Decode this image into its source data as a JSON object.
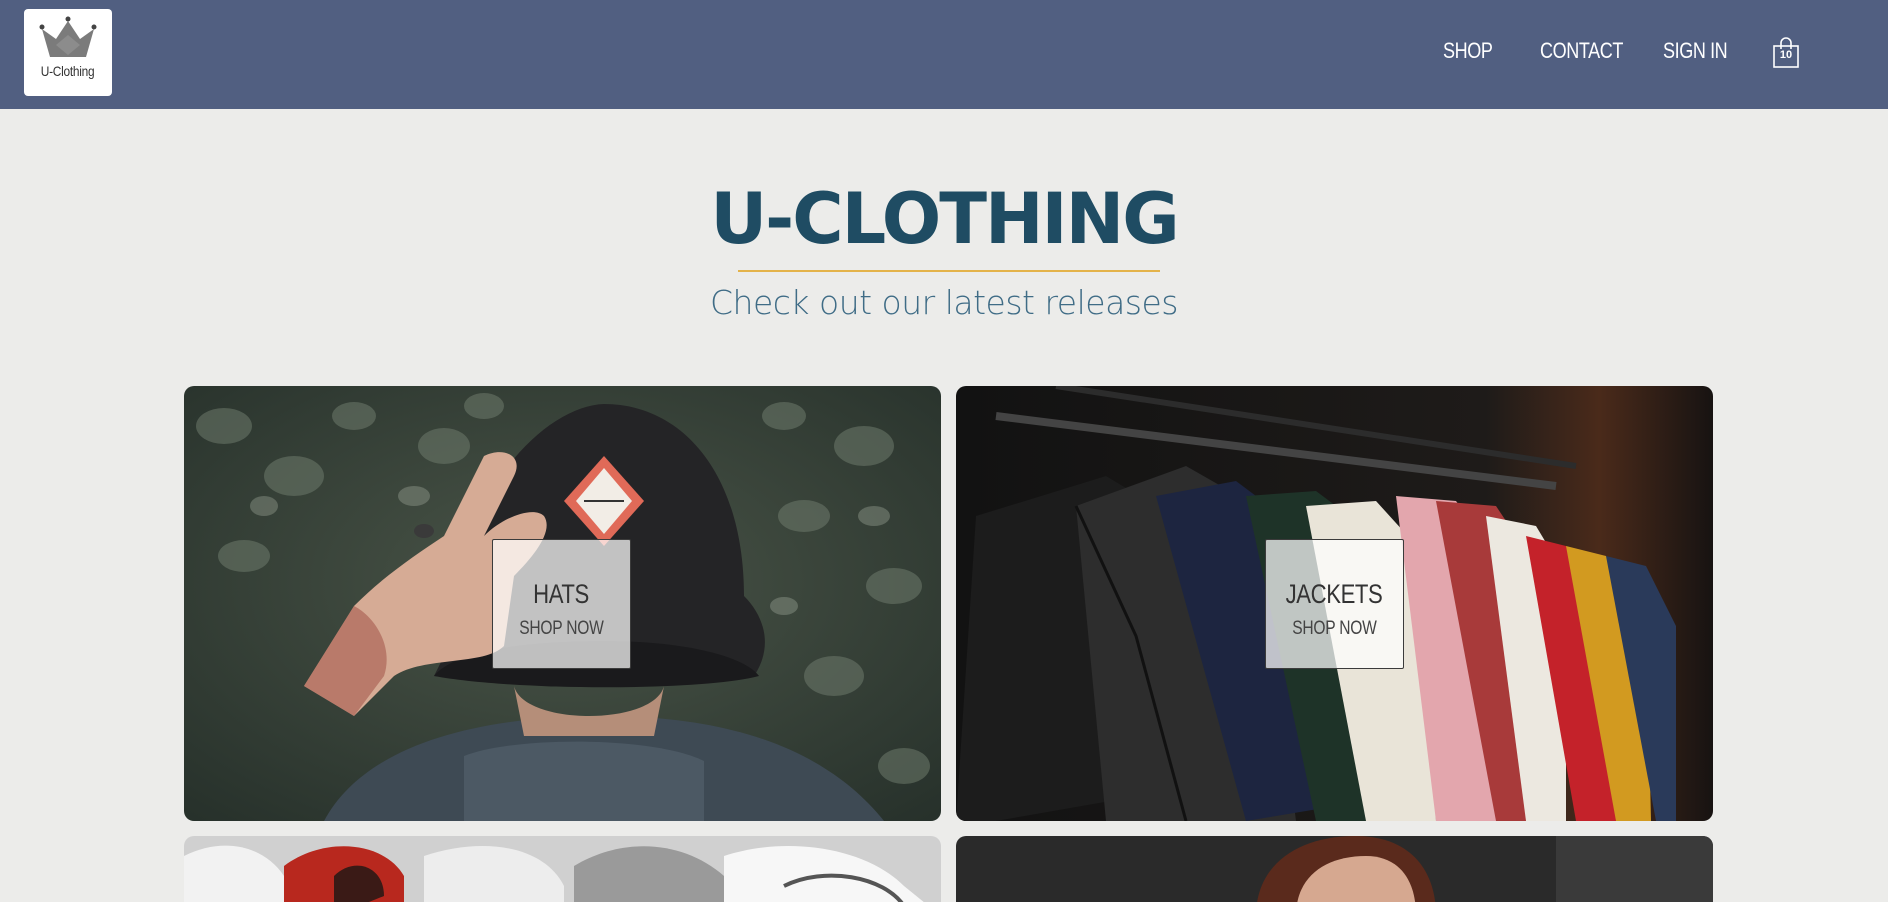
{
  "header": {
    "logo_text": "U-Clothing",
    "nav": [
      {
        "label": "SHOP"
      },
      {
        "label": "CONTACT"
      },
      {
        "label": "SIGN IN"
      }
    ],
    "cart_count": "10"
  },
  "hero": {
    "title": "U-CLOTHING",
    "subtitle": "Check out our latest releases"
  },
  "categories": [
    {
      "title": "HATS",
      "cta": "SHOP NOW"
    },
    {
      "title": "JACKETS",
      "cta": "SHOP NOW"
    },
    {
      "title": "",
      "cta": ""
    },
    {
      "title": "",
      "cta": ""
    }
  ],
  "colors": {
    "header_bg": "#515f81",
    "page_bg": "#ececea",
    "title": "#1f4c63",
    "accent_rule": "#e4b34a"
  }
}
